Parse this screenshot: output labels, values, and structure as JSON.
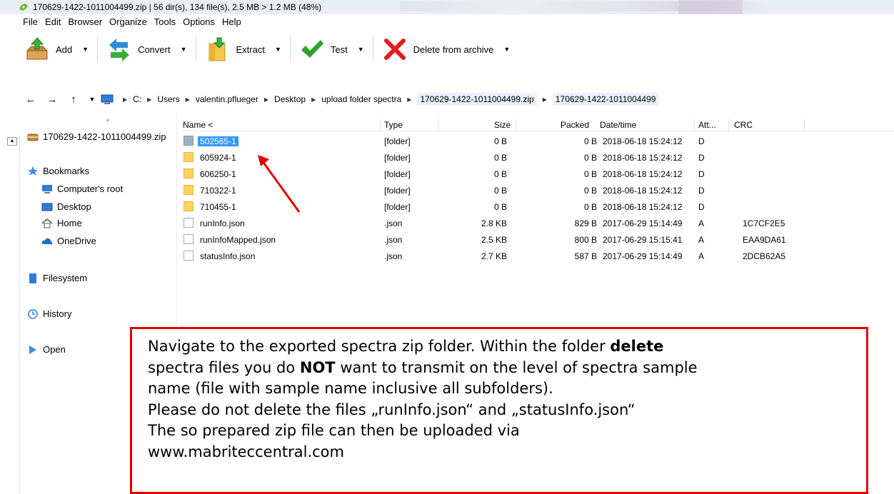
{
  "window": {
    "title": "170629-1422-1011004499.zip | 56 dir(s), 134 file(s), 2.5 MB > 1.2 MB (48%)"
  },
  "menu": [
    "File",
    "Edit",
    "Browser",
    "Organize",
    "Tools",
    "Options",
    "Help"
  ],
  "toolbar": {
    "add": "Add",
    "convert": "Convert",
    "extract": "Extract",
    "test": "Test",
    "delete": "Delete from archive"
  },
  "address": {
    "crumbs": [
      "C:",
      "Users",
      "valentin.pflueger",
      "Desktop",
      "upload folder spectra",
      "170629-1422-1011004499.zip",
      "170629-1422-1011004499"
    ]
  },
  "left": {
    "archive": "170629-1422-1011004499.zip",
    "bookmarks": "Bookmarks",
    "computer_root": "Computer's root",
    "desktop": "Desktop",
    "home": "Home",
    "onedrive": "OneDrive",
    "filesystem": "Filesystem",
    "history": "History",
    "open": "Open"
  },
  "columns": {
    "name": "Name <",
    "type": "Type",
    "size": "Size",
    "packed": "Packed",
    "date": "Date/time",
    "attr": "Att...",
    "crc": "CRC"
  },
  "rows": [
    {
      "name": "502565-1",
      "type": "[folder]",
      "size": "0 B",
      "packed": "0 B",
      "date": "2018-06-18 15:24:12",
      "attr": "D",
      "crc": ""
    },
    {
      "name": "605924-1",
      "type": "[folder]",
      "size": "0 B",
      "packed": "0 B",
      "date": "2018-06-18 15:24:12",
      "attr": "D",
      "crc": ""
    },
    {
      "name": "606250-1",
      "type": "[folder]",
      "size": "0 B",
      "packed": "0 B",
      "date": "2018-06-18 15:24:12",
      "attr": "D",
      "crc": ""
    },
    {
      "name": "710322-1",
      "type": "[folder]",
      "size": "0 B",
      "packed": "0 B",
      "date": "2018-06-18 15:24:12",
      "attr": "D",
      "crc": ""
    },
    {
      "name": "710455-1",
      "type": "[folder]",
      "size": "0 B",
      "packed": "0 B",
      "date": "2018-06-18 15:24:12",
      "attr": "D",
      "crc": ""
    },
    {
      "name": "runInfo.json",
      "type": ".json",
      "size": "2.8 KB",
      "packed": "829 B",
      "date": "2017-06-29 15:14:49",
      "attr": "A",
      "crc": "1C7CF2E5"
    },
    {
      "name": "runInfoMapped.json",
      "type": ".json",
      "size": "2.5 KB",
      "packed": "800 B",
      "date": "2017-06-29 15:15:41",
      "attr": "A",
      "crc": "EAA9DA61"
    },
    {
      "name": "statusInfo.json",
      "type": ".json",
      "size": "2.7 KB",
      "packed": "587 B",
      "date": "2017-06-29 15:14:49",
      "attr": "A",
      "crc": "2DCB62A5"
    }
  ],
  "callout": {
    "l1a": "Navigate to the exported spectra zip folder. Within the folder ",
    "l1b": "delete",
    "l2a": "spectra files you do ",
    "l2b": "NOT",
    "l2c": " want to transmit on the level of spectra sample",
    "l3": "name (file with sample name inclusive all subfolders).",
    "l4": "Please do not delete  the files „runInfo.json“ and „statusInfo.json“",
    "l5": "The so prepared zip file can then be uploaded via",
    "l6": "www.mabriteccentral.com"
  },
  "colors": {
    "annotation_red": "#e00000",
    "selection_blue": "#3399ff"
  }
}
